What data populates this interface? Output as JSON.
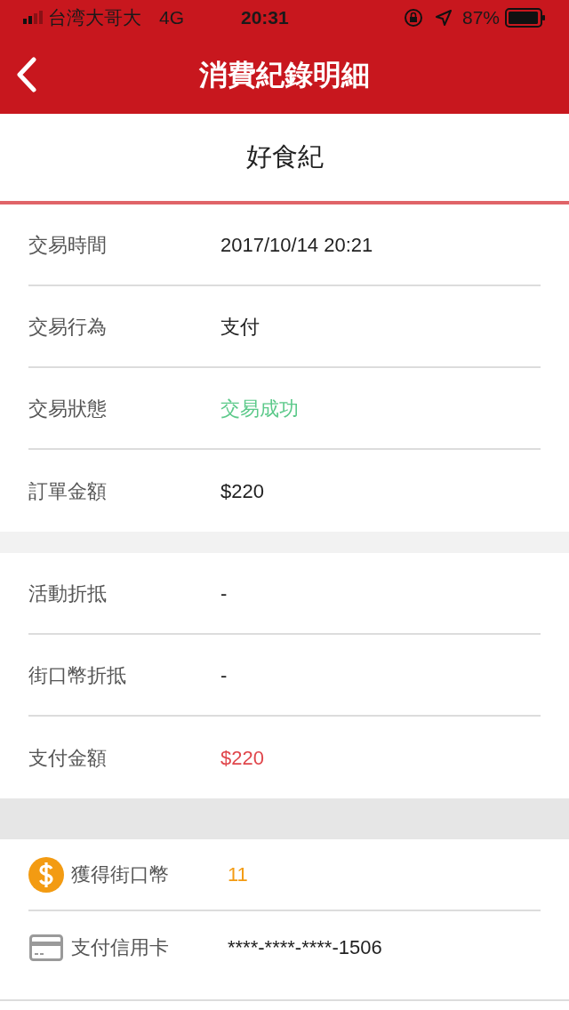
{
  "status_bar": {
    "carrier": "台湾大哥大",
    "network": "4G",
    "time": "20:31",
    "battery": "87%"
  },
  "nav": {
    "title": "消費紀錄明細"
  },
  "merchant": "好食紀",
  "sections": [
    {
      "rows": [
        {
          "label": "交易時間",
          "value": "2017/10/14 20:21",
          "color": "#222222"
        },
        {
          "label": "交易行為",
          "value": "支付",
          "color": "#222222"
        },
        {
          "label": "交易狀態",
          "value": "交易成功",
          "color": "#5cc98a"
        },
        {
          "label": "訂單金額",
          "value": "$220",
          "color": "#222222"
        }
      ]
    },
    {
      "rows": [
        {
          "label": "活動折抵",
          "value": "-",
          "color": "#222222"
        },
        {
          "label": "街口幣折抵",
          "value": "-",
          "color": "#222222"
        },
        {
          "label": "支付金額",
          "value": "$220",
          "color": "#e0464b"
        }
      ]
    },
    {
      "rows": [
        {
          "kind": "coin",
          "label": "獲得街口幣",
          "value": "11",
          "color": "#f39b12"
        },
        {
          "kind": "card",
          "label": "支付信用卡",
          "value": "****-****-****-1506",
          "color": "#222222"
        }
      ]
    }
  ]
}
